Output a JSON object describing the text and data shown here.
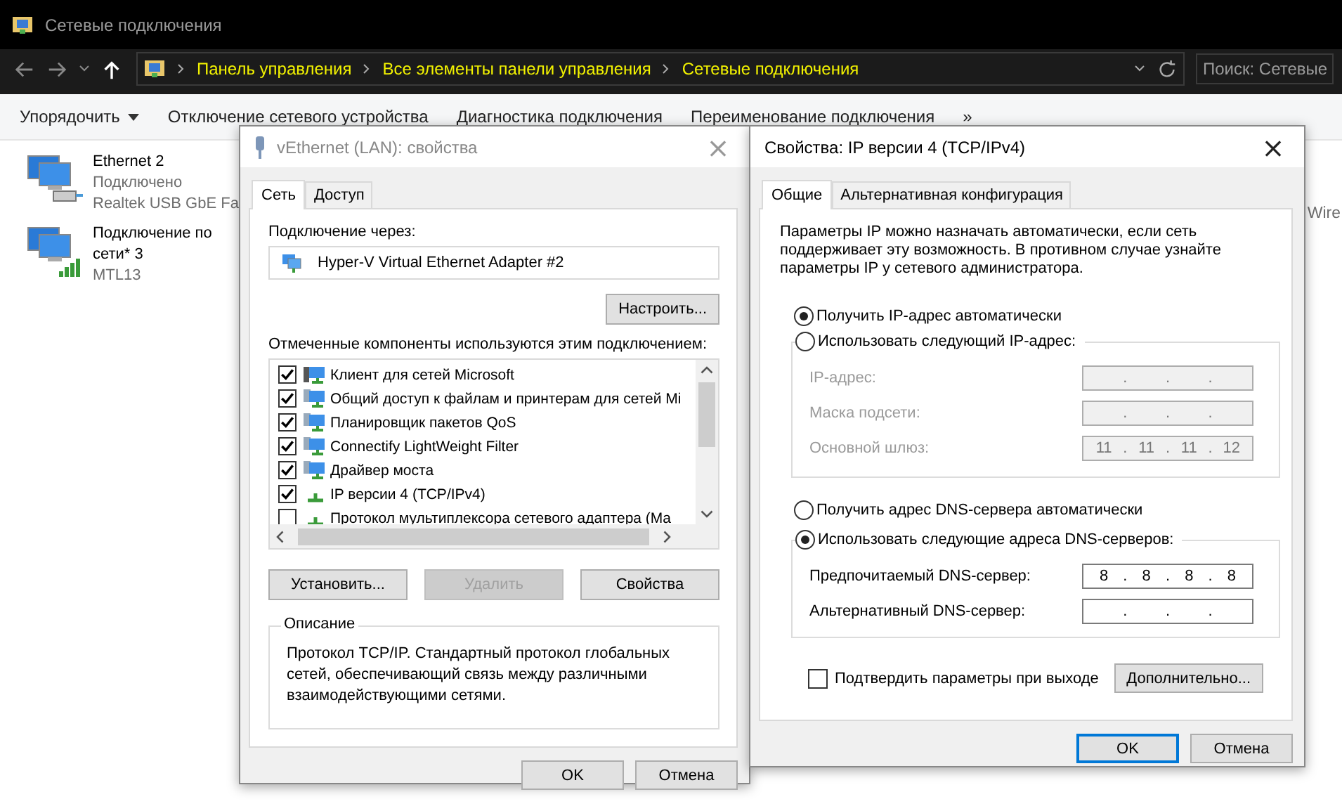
{
  "explorer": {
    "title": "Сетевые подключения",
    "breadcrumbs": [
      "Панель управления",
      "Все элементы панели управления",
      "Сетевые подключения"
    ],
    "search": {
      "placeholder": "Поиск: Сетевые"
    },
    "toolbar": [
      {
        "label": "Упорядочить",
        "kind": "menu"
      },
      {
        "label": "Отключение сетевого устройства",
        "kind": "plain"
      },
      {
        "label": "Диагностика подключения",
        "kind": "plain"
      },
      {
        "label": "Переименование подключения",
        "kind": "plain"
      },
      {
        "label": "»",
        "kind": "plain"
      }
    ],
    "connections": [
      {
        "kind": "wired",
        "name_lines": [
          "Ethernet 2"
        ],
        "lines": [
          "Подключено",
          "Realtek USB GbE Fa"
        ]
      },
      {
        "kind": "wireless",
        "name_lines": [
          "Подключение по",
          "сети* 3"
        ],
        "lines": [
          "MTL13"
        ]
      }
    ],
    "partial_item": "Wire"
  },
  "lan_dialog": {
    "title": "vEthernet (LAN): свойства",
    "close": "×",
    "tabs": [
      {
        "label": "Сеть",
        "selected": true
      },
      {
        "label": "Доступ",
        "selected": false
      }
    ],
    "connect_via_label": "Подключение через:",
    "adapter": "Hyper-V Virtual Ethernet Adapter #2",
    "configure_button": "Настроить...",
    "components_label": "Отмеченные компоненты используются этим подключением:",
    "components": [
      {
        "label": "Клиент для сетей Microsoft",
        "checked": true,
        "kind": "client"
      },
      {
        "label": "Общий доступ к файлам и принтерам для сетей Mi",
        "checked": true,
        "kind": "service"
      },
      {
        "label": "Планировщик пакетов QoS",
        "checked": true,
        "kind": "service"
      },
      {
        "label": "Connectify LightWeight Filter",
        "checked": true,
        "kind": "service"
      },
      {
        "label": "Драйвер моста",
        "checked": true,
        "kind": "service"
      },
      {
        "label": "IP версии 4 (TCP/IPv4)",
        "checked": true,
        "kind": "protocol"
      },
      {
        "label": "Протокол мультиплексора сетевого адаптера (Ma",
        "checked": false,
        "kind": "protocol"
      }
    ],
    "buttons": [
      {
        "label": "Установить...",
        "disabled": false
      },
      {
        "label": "Удалить",
        "disabled": true
      },
      {
        "label": "Свойства",
        "disabled": false
      }
    ],
    "description_title": "Описание",
    "description": "Протокол TCP/IP. Стандартный протокол глобальных сетей, обеспечивающий связь между различными взаимодействующими сетями.",
    "footer": [
      {
        "label": "OK",
        "default": false
      },
      {
        "label": "Отмена",
        "default": false
      }
    ]
  },
  "ipv4_dialog": {
    "title": "Свойства: IP версии 4 (TCP/IPv4)",
    "close": "×",
    "tabs": [
      {
        "label": "Общие",
        "selected": true
      },
      {
        "label": "Альтернативная конфигурация",
        "selected": false
      }
    ],
    "intro": "Параметры IP можно назначать автоматически, если сеть поддерживает эту возможность. В противном случае узнайте параметры IP у сетевого администратора.",
    "separator": ".",
    "ip_auto": {
      "label": "Получить IP-адрес автоматически",
      "selected": true
    },
    "ip_manual": {
      "label": "Использовать следующий IP-адрес:",
      "selected": false,
      "fields": [
        {
          "label": "IP-адрес:"
        },
        {
          "label": "Маска подсети:"
        },
        {
          "label": "Основной шлюз:",
          "octets": [
            "11",
            "11",
            "11",
            "12"
          ]
        }
      ]
    },
    "dns_auto": {
      "label": "Получить адрес DNS-сервера автоматически",
      "selected": false
    },
    "dns_manual": {
      "label": "Использовать следующие адреса DNS-серверов:",
      "selected": true,
      "fields": [
        {
          "label": "Предпочитаемый DNS-сервер:",
          "octets": [
            "8",
            "8",
            "8",
            "8"
          ]
        },
        {
          "label": "Альтернативный DNS-сервер:"
        }
      ]
    },
    "validate": {
      "label": "Подтвердить параметры при выходе",
      "checked": false
    },
    "advanced_button": "Дополнительно...",
    "footer": [
      {
        "label": "OK",
        "default": true
      },
      {
        "label": "Отмена",
        "default": false
      }
    ]
  }
}
